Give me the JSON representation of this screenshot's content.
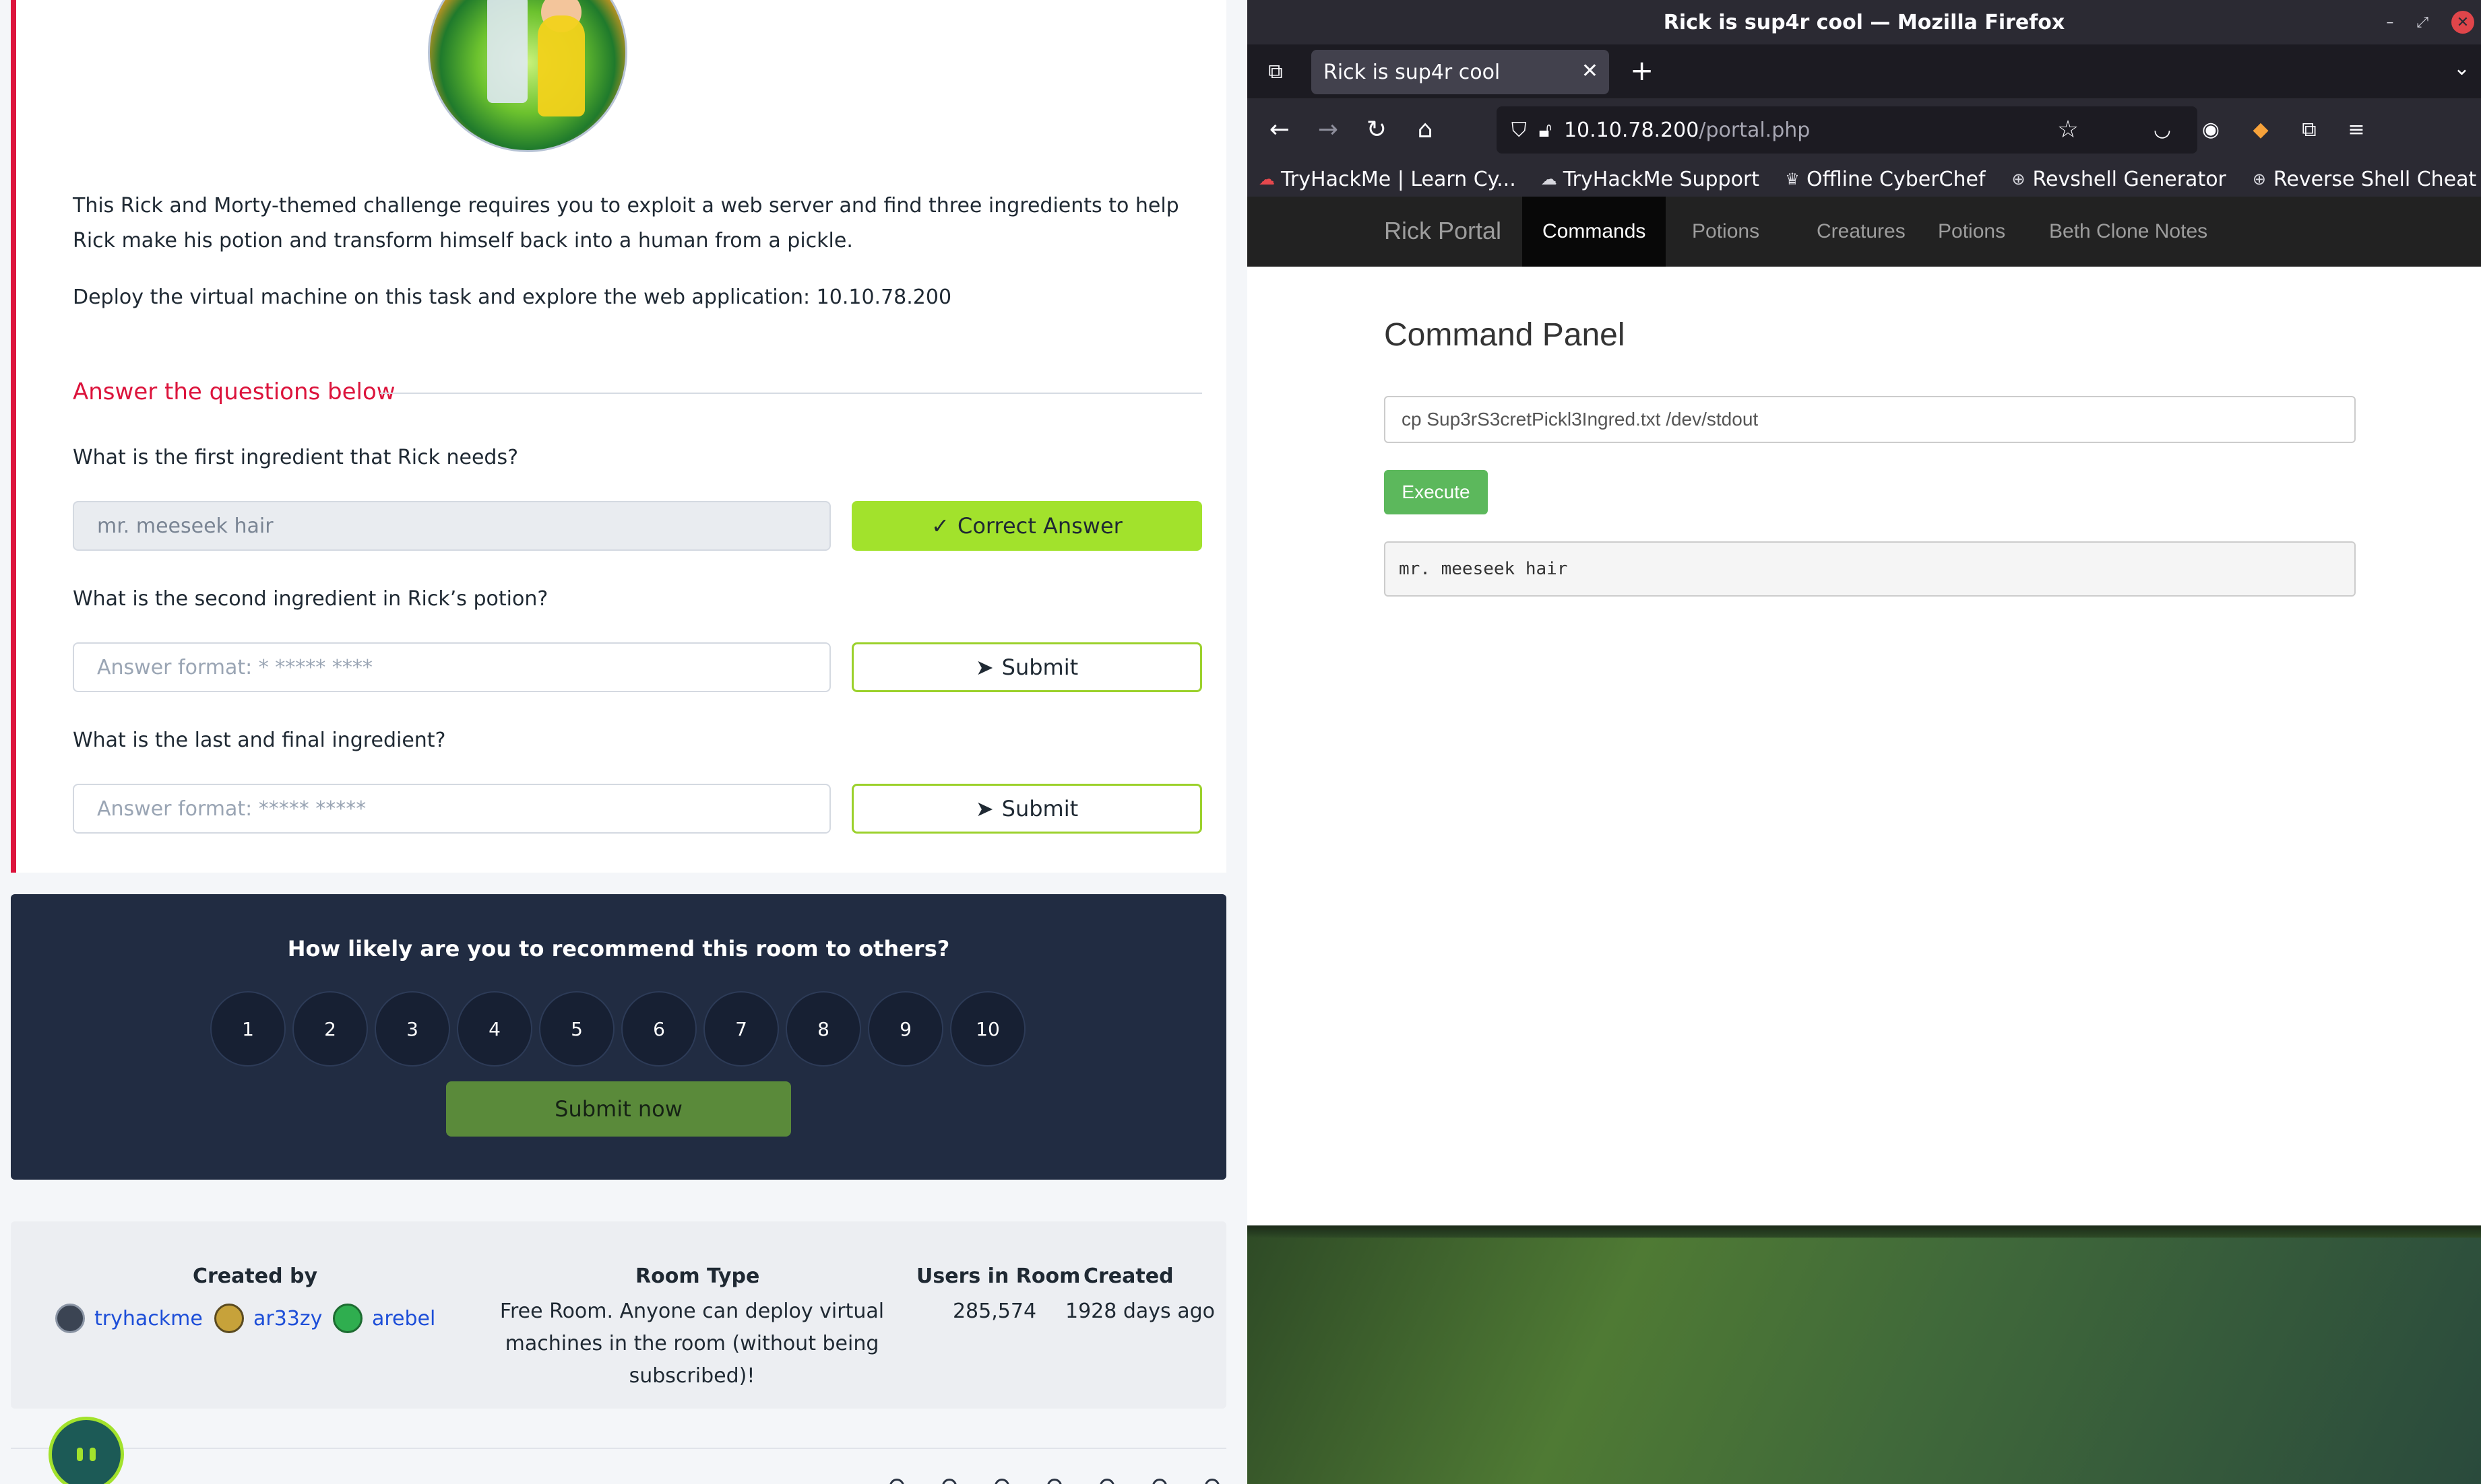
{
  "task": {
    "description": "This Rick and Morty-themed challenge requires you to exploit a web server and find three ingredients to help Rick make his potion and transform himself back into a human from a pickle.",
    "deploy": "Deploy the virtual machine on this task and explore the web application: 10.10.78.200",
    "answer_heading": "Answer the questions below",
    "questions": [
      {
        "text": "What is the first ingredient that Rick needs?",
        "value": "mr. meeseek hair",
        "button": "Correct Answer"
      },
      {
        "text": "What is the second ingredient in Rick’s potion?",
        "placeholder": "Answer format: * ***** ****",
        "button": "Submit"
      },
      {
        "text": "What is the last and final ingredient?",
        "placeholder": "Answer format: ***** *****",
        "button": "Submit"
      }
    ]
  },
  "rating": {
    "title": "How likely are you to recommend this room to others?",
    "options": [
      "1",
      "2",
      "3",
      "4",
      "5",
      "6",
      "7",
      "8",
      "9",
      "10"
    ],
    "submit": "Submit now"
  },
  "room_info": {
    "headers": {
      "created_by": "Created by",
      "room_type": "Room Type",
      "users": "Users in Room",
      "created": "Created"
    },
    "creators": [
      "tryhackme",
      "ar33zy",
      "arebel"
    ],
    "room_type": "Free Room. Anyone can deploy virtual machines in the room (without being subscribed)!",
    "users": "285,574",
    "created": "1928 days ago"
  },
  "browser": {
    "window_title": "Rick is sup4r cool — Mozilla Firefox",
    "tab_title": "Rick is sup4r cool",
    "url_host": "10.10.78.200",
    "url_path": "/portal.php",
    "bookmarks": [
      "TryHackMe | Learn Cy...",
      "TryHackMe Support",
      "Offline CyberChef",
      "Revshell Generator",
      "Reverse Shell Cheat S..."
    ]
  },
  "portal": {
    "brand": "Rick Portal",
    "nav": [
      "Commands",
      "Potions",
      "Creatures",
      "Potions",
      "Beth Clone Notes"
    ],
    "panel_title": "Command Panel",
    "command": "cp Sup3rS3cretPickl3Ingred.txt /dev/stdout",
    "execute": "Execute",
    "output": "mr. meeseek hair"
  },
  "colors": {
    "accent": "#dc143c",
    "success": "#a2e22c",
    "execute": "#5cb85c",
    "rating_bg": "#212c42"
  }
}
